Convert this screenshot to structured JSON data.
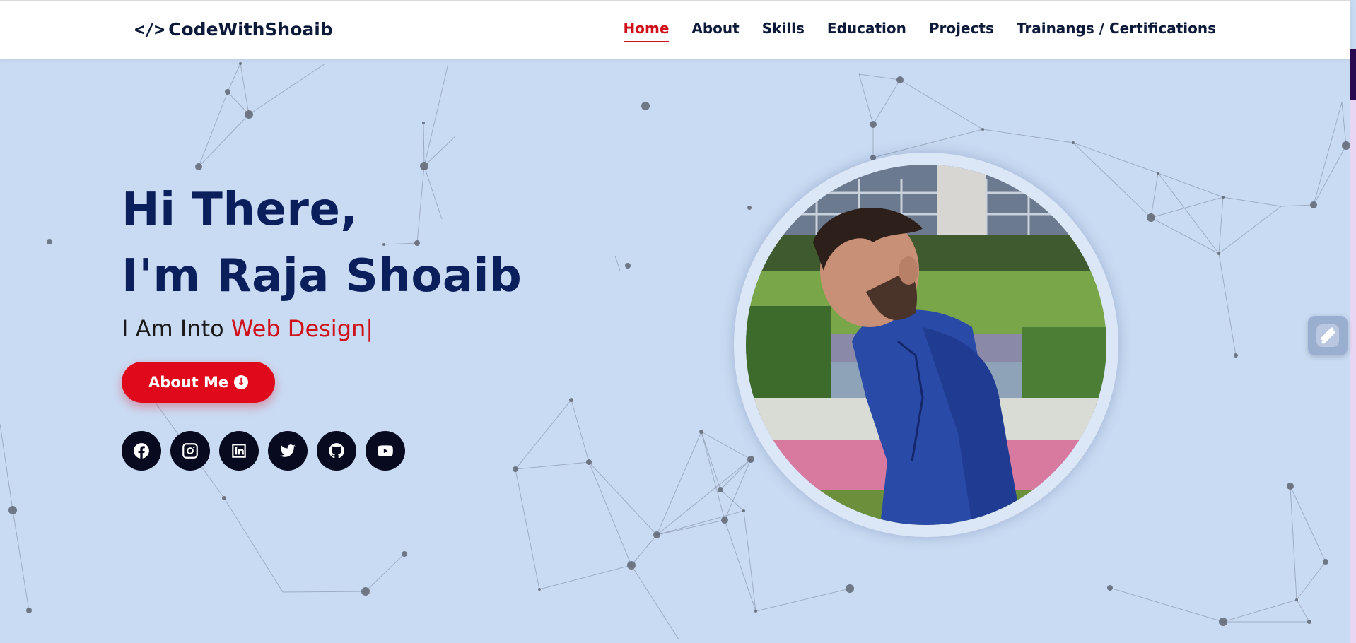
{
  "brand": {
    "logo_icon": "code-icon",
    "logo_symbol": "</>",
    "name": "CodeWithShoaib"
  },
  "nav": {
    "items": [
      {
        "label": "Home",
        "active": true
      },
      {
        "label": "About",
        "active": false
      },
      {
        "label": "Skills",
        "active": false
      },
      {
        "label": "Education",
        "active": false
      },
      {
        "label": "Projects",
        "active": false
      },
      {
        "label": "Trainangs / Certifications",
        "active": false
      }
    ]
  },
  "hero": {
    "greeting": "Hi There,",
    "name_line": "I'm Raja Shoaib",
    "intro_prefix": "I Am Into",
    "intro_role": "Web Design",
    "cursor": "|",
    "cta_label": "About Me",
    "cta_icon": "arrow-down-circle-icon"
  },
  "socials": [
    {
      "name": "facebook-icon"
    },
    {
      "name": "instagram-icon"
    },
    {
      "name": "linkedin-icon"
    },
    {
      "name": "twitter-icon"
    },
    {
      "name": "github-icon"
    },
    {
      "name": "youtube-icon"
    }
  ],
  "profile": {
    "image": "profile-photo"
  },
  "widget": {
    "icon": "assistant-icon"
  },
  "colors": {
    "primary": "#0a1f5c",
    "accent": "#e0091c",
    "background": "#c9dbf3",
    "nav_text": "#0e1a3a",
    "social_bg": "#080b1f"
  }
}
